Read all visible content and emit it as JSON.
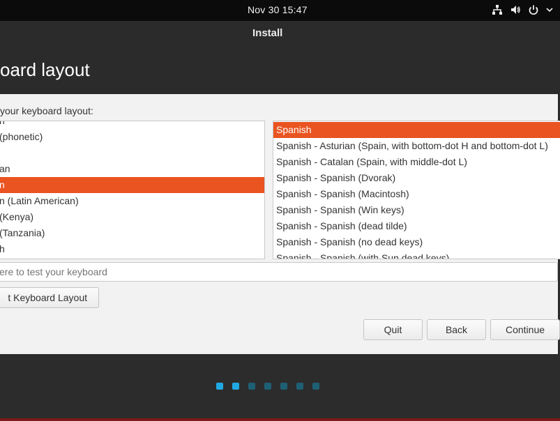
{
  "topbar": {
    "clock": "Nov 30  15:47",
    "icons": [
      "network-icon",
      "volume-icon",
      "power-icon",
      "chevron-down-icon"
    ]
  },
  "window": {
    "title": "Install"
  },
  "header": {
    "heading": "oard layout"
  },
  "content": {
    "prompt": "your keyboard layout:",
    "left_list": [
      {
        "label": "n",
        "selected": false
      },
      {
        "label": " (phonetic)",
        "selected": false
      },
      {
        "label": "",
        "selected": false
      },
      {
        "label": "an",
        "selected": false
      },
      {
        "label": "n",
        "selected": true
      },
      {
        "label": "n (Latin American)",
        "selected": false
      },
      {
        "label": " (Kenya)",
        "selected": false
      },
      {
        "label": " (Tanzania)",
        "selected": false
      },
      {
        "label": "h",
        "selected": false
      }
    ],
    "right_list": [
      {
        "label": "Spanish",
        "selected": true
      },
      {
        "label": "Spanish - Asturian (Spain, with bottom-dot H and bottom-dot L)",
        "selected": false
      },
      {
        "label": "Spanish - Catalan (Spain, with middle-dot L)",
        "selected": false
      },
      {
        "label": "Spanish - Spanish (Dvorak)",
        "selected": false
      },
      {
        "label": "Spanish - Spanish (Macintosh)",
        "selected": false
      },
      {
        "label": "Spanish - Spanish (Win keys)",
        "selected": false
      },
      {
        "label": "Spanish - Spanish (dead tilde)",
        "selected": false
      },
      {
        "label": "Spanish - Spanish (no dead keys)",
        "selected": false
      },
      {
        "label": "Spanish - Spanish (with Sun dead keys)",
        "selected": false
      }
    ],
    "test_placeholder": "ere to test your keyboard",
    "detect_label": "t Keyboard Layout",
    "quit_label": "Quit",
    "back_label": "Back",
    "continue_label": "Continue"
  },
  "progress": {
    "total_steps": 7,
    "completed_steps": 2,
    "active_color": "#1fa9e2",
    "inactive_color": "#1d5f75"
  },
  "colors": {
    "selection": "#e95420",
    "topbar": "#0b0b0b",
    "window_dark": "#2b2b2b",
    "content_bg": "#f2f2f2"
  }
}
